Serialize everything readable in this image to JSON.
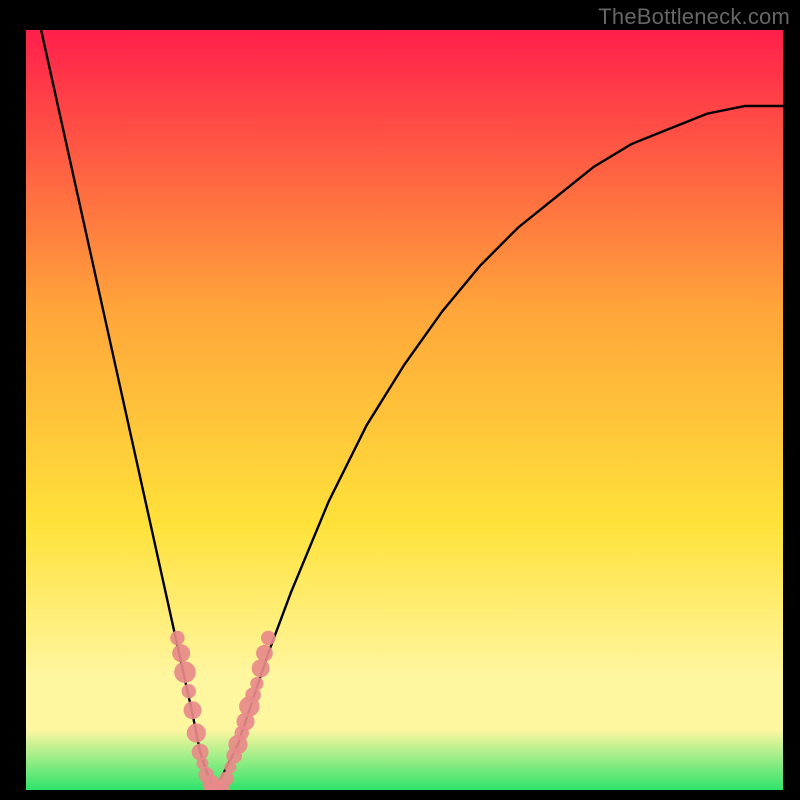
{
  "watermark": "TheBottleneck.com",
  "chart_data": {
    "type": "line",
    "title": "",
    "xlabel": "",
    "ylabel": "",
    "xlim": [
      0,
      100
    ],
    "ylim": [
      0,
      100
    ],
    "background_gradient": {
      "top": "#ff1f4b",
      "mid_upper": "#ffa63a",
      "mid": "#ffe23a",
      "mid_lower": "#fff6a0",
      "bottom": "#2fe36b"
    },
    "colors": {
      "curve": "#000000",
      "marker_fill": "#e88a8a",
      "marker_stroke": "#e88a8a",
      "frame": "#000000"
    },
    "series": [
      {
        "name": "bottleneck-curve",
        "x": [
          2,
          4,
          6,
          8,
          10,
          12,
          14,
          16,
          18,
          20,
          22,
          23,
          24,
          25,
          26,
          28,
          30,
          32,
          35,
          40,
          45,
          50,
          55,
          60,
          65,
          70,
          75,
          80,
          85,
          90,
          95,
          100
        ],
        "y": [
          100,
          91,
          82,
          73,
          64,
          55,
          46,
          37,
          28,
          19,
          10,
          5,
          2,
          0,
          2,
          6,
          12,
          18,
          26,
          38,
          48,
          56,
          63,
          69,
          74,
          78,
          82,
          85,
          87,
          89,
          90,
          90
        ]
      }
    ],
    "markers": {
      "name": "bottleneck-markers",
      "points": [
        {
          "x": 20.0,
          "y": 20.0,
          "r": 1.2
        },
        {
          "x": 20.5,
          "y": 18.0,
          "r": 1.5
        },
        {
          "x": 21.0,
          "y": 15.5,
          "r": 1.8
        },
        {
          "x": 21.5,
          "y": 13.0,
          "r": 1.2
        },
        {
          "x": 22.0,
          "y": 10.5,
          "r": 1.5
        },
        {
          "x": 22.5,
          "y": 7.5,
          "r": 1.6
        },
        {
          "x": 23.0,
          "y": 5.0,
          "r": 1.4
        },
        {
          "x": 23.3,
          "y": 3.5,
          "r": 1.0
        },
        {
          "x": 23.8,
          "y": 2.0,
          "r": 1.3
        },
        {
          "x": 24.5,
          "y": 0.8,
          "r": 1.5
        },
        {
          "x": 25.0,
          "y": 0.0,
          "r": 1.6
        },
        {
          "x": 25.8,
          "y": 0.3,
          "r": 1.4
        },
        {
          "x": 26.5,
          "y": 1.5,
          "r": 1.2
        },
        {
          "x": 27.0,
          "y": 3.0,
          "r": 1.0
        },
        {
          "x": 27.5,
          "y": 4.5,
          "r": 1.3
        },
        {
          "x": 28.0,
          "y": 6.0,
          "r": 1.6
        },
        {
          "x": 28.5,
          "y": 7.5,
          "r": 1.2
        },
        {
          "x": 29.0,
          "y": 9.0,
          "r": 1.5
        },
        {
          "x": 29.5,
          "y": 11.0,
          "r": 1.7
        },
        {
          "x": 30.0,
          "y": 12.5,
          "r": 1.3
        },
        {
          "x": 30.5,
          "y": 14.0,
          "r": 1.1
        },
        {
          "x": 31.0,
          "y": 16.0,
          "r": 1.5
        },
        {
          "x": 31.5,
          "y": 18.0,
          "r": 1.4
        },
        {
          "x": 32.0,
          "y": 20.0,
          "r": 1.2
        }
      ]
    }
  }
}
